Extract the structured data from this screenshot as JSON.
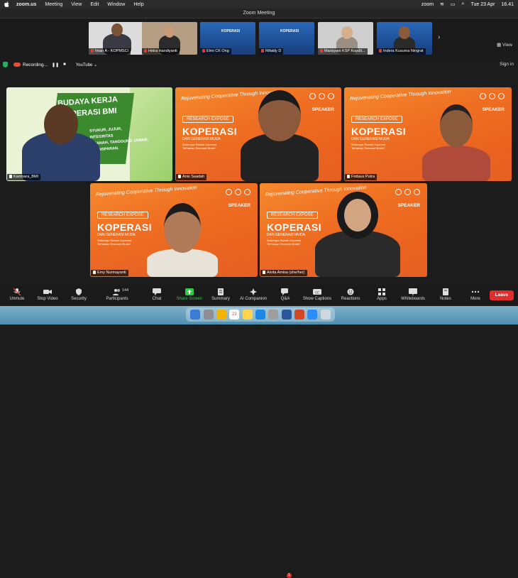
{
  "menubar": {
    "app": "zoom.us",
    "items": [
      "Meeting",
      "View",
      "Edit",
      "Window",
      "Help"
    ],
    "status_app": "zoom",
    "date": "Tue 23 Apr",
    "time": "16.41"
  },
  "window": {
    "title": "Zoom Meeting"
  },
  "strip": {
    "view_label": "View",
    "thumbs": [
      {
        "name": "Iman A - KOPMSCI"
      },
      {
        "name": "Heira Handiyanti"
      },
      {
        "name": "Elmi CK Ong"
      },
      {
        "name": "Rifaldy D"
      },
      {
        "name": "Marsiyani KSP Kopdit..."
      },
      {
        "name": "Indera Kusuma Ningrat"
      }
    ],
    "slide_text": "KOPERASI"
  },
  "recbar": {
    "recording_label": "Recording...",
    "youtube_label": "YouTube",
    "signin_label": "Sign in"
  },
  "slide": {
    "header": "Rejuvenating Cooperative Through Innovation",
    "speaker": "SPEAKER",
    "research": "RESEARCH EXPOSE",
    "title": "KOPERASI",
    "subtitle": "DAN GENERASI MUDA",
    "body": "Seberapa Ramah Koperasi Terhadap Generasi Muda?"
  },
  "bmi_slide": {
    "line1": "BUDAYA KERJA",
    "line2": "KOPERASI BMI",
    "values": [
      "SYUKUR, JUJUR,",
      "INTEGRITAS",
      "AMANAH, TANGGUNG JAWAB,",
      "TRANSPARAN."
    ]
  },
  "tiles": [
    {
      "name": "Kambara_BMI"
    },
    {
      "name": "Anis Saadah"
    },
    {
      "name": "Firdaus Putra"
    },
    {
      "name": "Emy Nurmayanti"
    },
    {
      "name": "Alvita Amisa (she/her)"
    }
  ],
  "toolbar": {
    "items": [
      {
        "label": "Unmute",
        "icon": "mic-off-icon"
      },
      {
        "label": "Stop Video",
        "icon": "video-icon"
      },
      {
        "label": "Security",
        "icon": "shield-icon"
      },
      {
        "label": "Participants",
        "icon": "participants-icon",
        "count": "144"
      },
      {
        "label": "Chat",
        "icon": "chat-icon"
      },
      {
        "label": "Share Screen",
        "icon": "share-icon"
      },
      {
        "label": "Summary",
        "icon": "summary-icon"
      },
      {
        "label": "AI Companion",
        "icon": "sparkle-icon"
      },
      {
        "label": "Q&A",
        "icon": "qa-icon",
        "badge": "1"
      },
      {
        "label": "Show Captions",
        "icon": "cc-icon"
      },
      {
        "label": "Reactions",
        "icon": "reactions-icon"
      },
      {
        "label": "Apps",
        "icon": "apps-icon"
      },
      {
        "label": "Whiteboards",
        "icon": "whiteboard-icon"
      },
      {
        "label": "Notes",
        "icon": "notes-icon"
      },
      {
        "label": "More",
        "icon": "more-icon"
      }
    ],
    "leave_label": "Leave"
  },
  "dock": {
    "calendar_day": "23"
  },
  "colors": {
    "leave": "#e02e2e",
    "share": "#2ecc40",
    "slide_orange": "#ef6f22"
  }
}
